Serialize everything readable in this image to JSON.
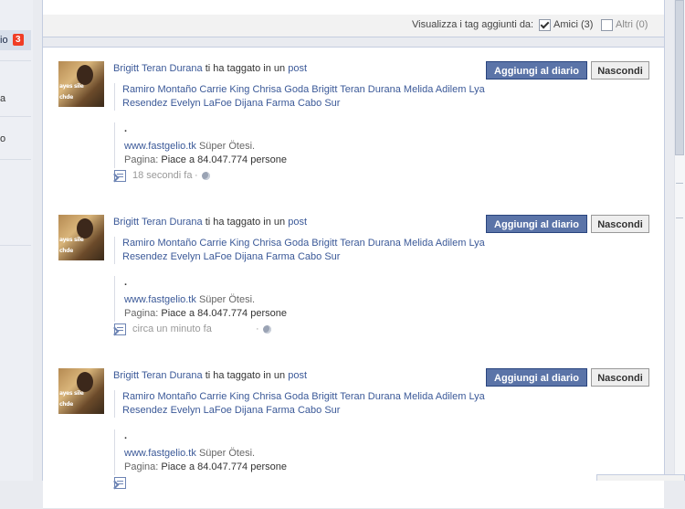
{
  "sidebar": {
    "active_item": {
      "label": "io",
      "count": "3"
    },
    "fragments": [
      "a",
      "o"
    ]
  },
  "filter": {
    "label": "Visualizza i tag aggiunti da:",
    "options": [
      {
        "label": "Amici (3)",
        "checked": true
      },
      {
        "label": "Altri (0)",
        "checked": false
      }
    ]
  },
  "stories": [
    {
      "actor": "Brigitt Teran Durana",
      "verb": "ti ha taggato in un",
      "object": "post",
      "tags": "Ramiro Montaño Carrie King Chrisa Goda Brigitt Teran Durana Melida Adilem Lya Resendez Evelyn LaFoe Dijana Farma Cabo Sur",
      "attachment": {
        "dot": ".",
        "url": "www.fastgelio.tk",
        "subtitle": "Süper Ötesi.",
        "page_key": "Pagina:",
        "page_value": "Piace a 84.047.774 persone"
      },
      "time": "18 secondi fa",
      "add_button": "Aggiungi al diario",
      "hide_button": "Nascondi"
    },
    {
      "actor": "Brigitt Teran Durana",
      "verb": "ti ha taggato in un",
      "object": "post",
      "tags": "Ramiro Montaño Carrie King Chrisa Goda Brigitt Teran Durana Melida Adilem Lya Resendez Evelyn LaFoe Dijana Farma Cabo Sur",
      "attachment": {
        "dot": ".",
        "url": "www.fastgelio.tk",
        "subtitle": "Süper Ötesi.",
        "page_key": "Pagina:",
        "page_value": "Piace a 84.047.774 persone"
      },
      "time": "circa un minuto fa",
      "add_button": "Aggiungi al diario",
      "hide_button": "Nascondi"
    },
    {
      "actor": "Brigitt Teran Durana",
      "verb": "ti ha taggato in un",
      "object": "post",
      "tags": "Ramiro Montaño Carrie King Chrisa Goda Brigitt Teran Durana Melida Adilem Lya Resendez Evelyn LaFoe Dijana Farma Cabo Sur",
      "attachment": {
        "dot": ".",
        "url": "www.fastgelio.tk",
        "subtitle": "Süper Ötesi.",
        "page_key": "Pagina:",
        "page_value": "Piace a 84.047.774 persone"
      },
      "time": "",
      "add_button": "Aggiungi al diario",
      "hide_button": "Nascondi"
    }
  ],
  "thumbnail_text": {
    "line1": "ayes sile",
    "line2": "chde"
  },
  "colors": {
    "link": "#3b5998",
    "primary_button": "#5b74a8",
    "badge": "#f03d25"
  }
}
